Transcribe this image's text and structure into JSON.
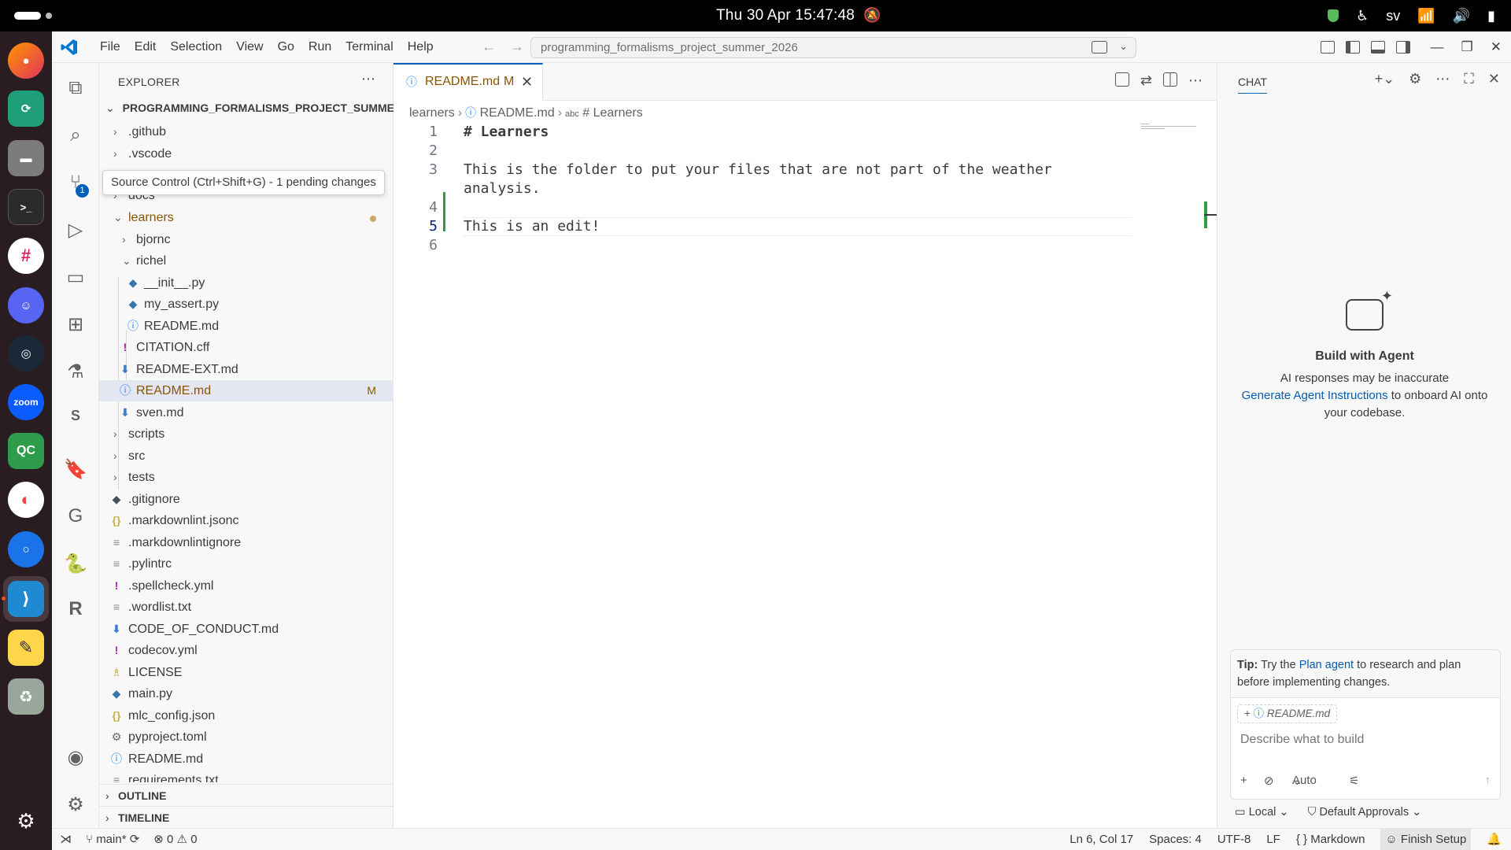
{
  "system": {
    "clock": "Thu 30 Apr  15:47:48",
    "keyboard_layout": "sv"
  },
  "titlebar": {
    "menus": [
      "File",
      "Edit",
      "Selection",
      "View",
      "Go",
      "Run",
      "Terminal",
      "Help"
    ],
    "search_text": "programming_formalisms_project_summer_2026"
  },
  "activity": {
    "scm_badge": "1",
    "tooltip": "Source Control (Ctrl+Shift+G) - 1 pending changes"
  },
  "explorer": {
    "header": "EXPLORER",
    "root": "PROGRAMMING_FORMALISMS_PROJECT_SUMMER...",
    "items": [
      {
        "label": ".github",
        "kind": "folder"
      },
      {
        "label": ".vscode",
        "kind": "folder"
      },
      {
        "label": "docs",
        "kind": "folder"
      },
      {
        "label": "learners",
        "kind": "folder-open"
      },
      {
        "label": "bjornc",
        "kind": "folder"
      },
      {
        "label": "richel",
        "kind": "folder-open"
      },
      {
        "label": "__init__.py",
        "kind": "python"
      },
      {
        "label": "my_assert.py",
        "kind": "python"
      },
      {
        "label": "README.md",
        "kind": "info"
      },
      {
        "label": "CITATION.cff",
        "kind": "excl"
      },
      {
        "label": "README-EXT.md",
        "kind": "md"
      },
      {
        "label": "README.md",
        "kind": "info",
        "mark": "M"
      },
      {
        "label": "sven.md",
        "kind": "md"
      },
      {
        "label": "scripts",
        "kind": "folder"
      },
      {
        "label": "src",
        "kind": "folder"
      },
      {
        "label": "tests",
        "kind": "folder"
      },
      {
        "label": ".gitignore",
        "kind": "git"
      },
      {
        "label": ".markdownlint.jsonc",
        "kind": "json"
      },
      {
        "label": ".markdownlintignore",
        "kind": "lines"
      },
      {
        "label": ".pylintrc",
        "kind": "lines"
      },
      {
        "label": ".spellcheck.yml",
        "kind": "excl"
      },
      {
        "label": ".wordlist.txt",
        "kind": "lines"
      },
      {
        "label": "CODE_OF_CONDUCT.md",
        "kind": "md"
      },
      {
        "label": "codecov.yml",
        "kind": "excl"
      },
      {
        "label": "LICENSE",
        "kind": "license"
      },
      {
        "label": "main.py",
        "kind": "python"
      },
      {
        "label": "mlc_config.json",
        "kind": "json"
      },
      {
        "label": "pyproject.toml",
        "kind": "gear"
      },
      {
        "label": "README.md",
        "kind": "info"
      },
      {
        "label": "requirements.txt",
        "kind": "lines"
      }
    ],
    "outline": "OUTLINE",
    "timeline": "TIMELINE"
  },
  "editor": {
    "tab_name": "README.md",
    "tab_mark": "M",
    "breadcrumbs": [
      "learners",
      "README.md",
      "# Learners"
    ],
    "lines": [
      {
        "n": "1",
        "text": "# Learners"
      },
      {
        "n": "2",
        "text": ""
      },
      {
        "n": "3",
        "text": "This is the folder to put your files that are not part of the weather"
      },
      {
        "n": "",
        "text": "analysis."
      },
      {
        "n": "4",
        "text": ""
      },
      {
        "n": "5",
        "text": "This is an edit!"
      },
      {
        "n": "6",
        "text": ""
      }
    ]
  },
  "chat": {
    "tab": "CHAT",
    "title": "Build with Agent",
    "disclaimer": "AI responses may be inaccurate",
    "link": "Generate Agent Instructions",
    "after_link": " to onboard AI onto your codebase.",
    "tip_label": "Tip:",
    "tip_pre": " Try the ",
    "tip_link": "Plan agent",
    "tip_post": " to research and plan before implementing changes.",
    "context_file": "README.md",
    "placeholder": "Describe what to build",
    "mode": "Auto",
    "location": "Local",
    "approvals": "Default Approvals"
  },
  "status": {
    "branch": "main*",
    "errors": "0",
    "warnings": "0",
    "position": "Ln 6, Col 17",
    "spaces": "Spaces: 4",
    "encoding": "UTF-8",
    "eol": "LF",
    "language": "Markdown",
    "finish": "Finish Setup"
  },
  "colors": {
    "accent": "#005fb8",
    "modified": "#895503",
    "heading": "#800000",
    "added_gutter": "#2ea043"
  }
}
